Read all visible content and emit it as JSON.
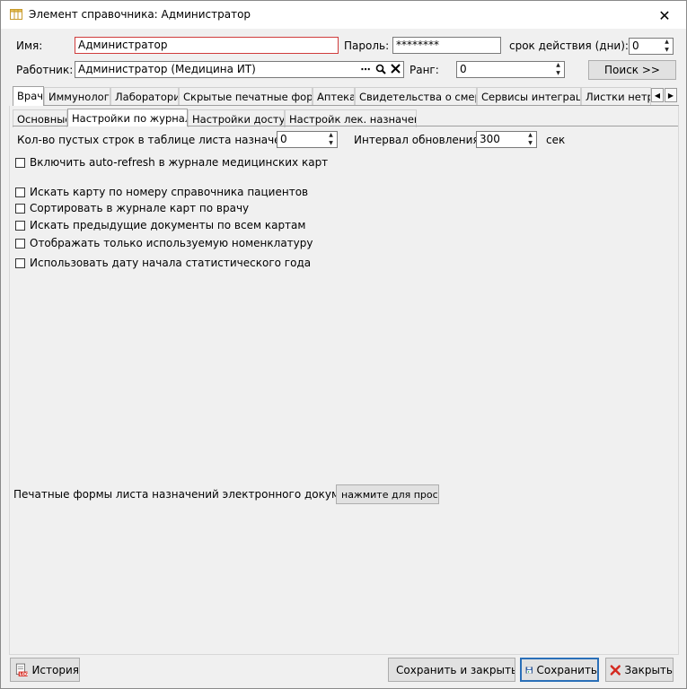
{
  "window": {
    "title": "Элемент справочника: Администратор",
    "close_glyph": "✕"
  },
  "header": {
    "name_label": "Имя:",
    "name_value": "Администратор",
    "password_label": "Пароль:",
    "password_value": "********",
    "validity_label": "срок действия (дни):",
    "validity_value": "0",
    "worker_label": "Работник:",
    "worker_value": "Администратор (Медицина ИТ)",
    "rank_label": "Ранг:",
    "rank_value": "0",
    "search_button": "Поиск  >>"
  },
  "main_tabs": [
    "Врач",
    "Иммунология",
    "Лаборатория",
    "Скрытые печатные формы",
    "Аптека",
    "Свидетельства о смерти",
    "Сервисы интеграции",
    "Листки нетру"
  ],
  "sub_tabs": [
    "Основные",
    "Настройки по журналам",
    "Настройки доступа",
    "Настройк лек. назначений"
  ],
  "content": {
    "empty_rows_label": "Кол-во пустых строк в таблице листа назначения:",
    "empty_rows_value": "0",
    "refresh_label": "Интервал обновления:",
    "refresh_value": "300",
    "refresh_unit": "сек",
    "checkboxes": [
      "Включить auto-refresh в журнале медицинских карт",
      "Искать карту по номеру справочника пациентов",
      "Сортировать в журнале карт по врачу",
      "Искать предыдущие документы по всем картам",
      "Отображать только используемую номенклатуру",
      "Использовать дату начала статистического года"
    ],
    "print_forms_label": "Печатные формы листа назначений электронного документа",
    "print_forms_button": "нажмите для просмот"
  },
  "footer": {
    "history": "История",
    "save_close": "Сохранить и закрыть",
    "save": "Сохранить",
    "close": "Закрыть"
  },
  "icons": {
    "window_icon": "grid-icon",
    "dots": "ellipsis-icon",
    "search": "magnifier-icon",
    "clear": "x-icon"
  }
}
